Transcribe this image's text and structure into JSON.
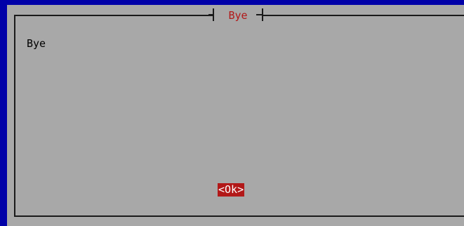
{
  "dialog": {
    "title": "Bye",
    "message": "Bye",
    "ok_label": "<Ok>"
  },
  "colors": {
    "background": "#0000a8",
    "dialog": "#a8a8a8",
    "title_text": "#b21818",
    "button_bg": "#b21818",
    "button_text": "#ffffff"
  }
}
